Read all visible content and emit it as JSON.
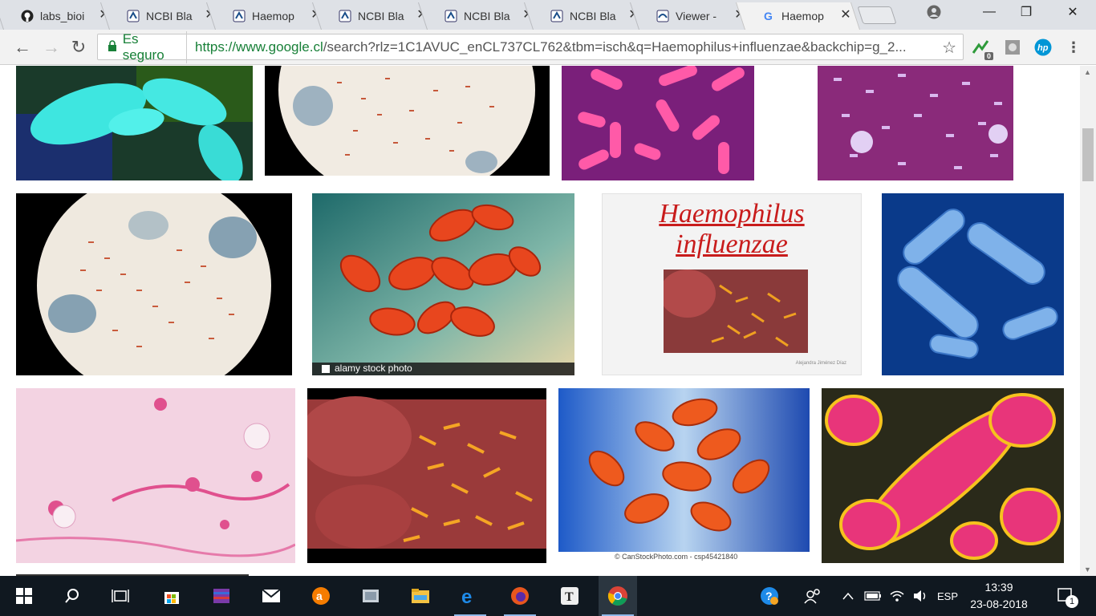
{
  "browser": {
    "tabs": [
      {
        "title": "labs_bioi",
        "favicon": "github-icon"
      },
      {
        "title": "NCBI Bla",
        "favicon": "ncbi-icon"
      },
      {
        "title": "Haemop",
        "favicon": "ncbi-icon"
      },
      {
        "title": "NCBI Bla",
        "favicon": "ncbi-icon"
      },
      {
        "title": "NCBI Bla",
        "favicon": "ncbi-icon"
      },
      {
        "title": "NCBI Bla",
        "favicon": "ncbi-icon"
      },
      {
        "title": "Viewer -",
        "favicon": "viewer-icon"
      },
      {
        "title": "Haemop",
        "favicon": "google-icon",
        "active": true
      }
    ],
    "security_label": "Es seguro",
    "url_host": "https://www.google.cl",
    "url_rest": "/search?rlz=1C1AVUC_enCL737CL762&tbm=isch&q=Haemophilus+influenzae&backchip=g_2...",
    "extension_badge": "0"
  },
  "results": {
    "text_overlays": {
      "alamy_caption": "alamy stock photo",
      "slide_title_line1": "Haemophilus",
      "slide_title_line2": "influenzae",
      "slide_author": "Alejandra Jiménez Díaz",
      "canstock_caption": "© CanStockPhoto.com - csp45421840"
    }
  },
  "taskbar": {
    "language": "ESP",
    "time": "13:39",
    "date": "23-08-2018",
    "notification_count": "1"
  },
  "colors": {
    "secure_green": "#188038",
    "taskbar_bg": "#101820",
    "tab_bg": "#dee1e6"
  }
}
